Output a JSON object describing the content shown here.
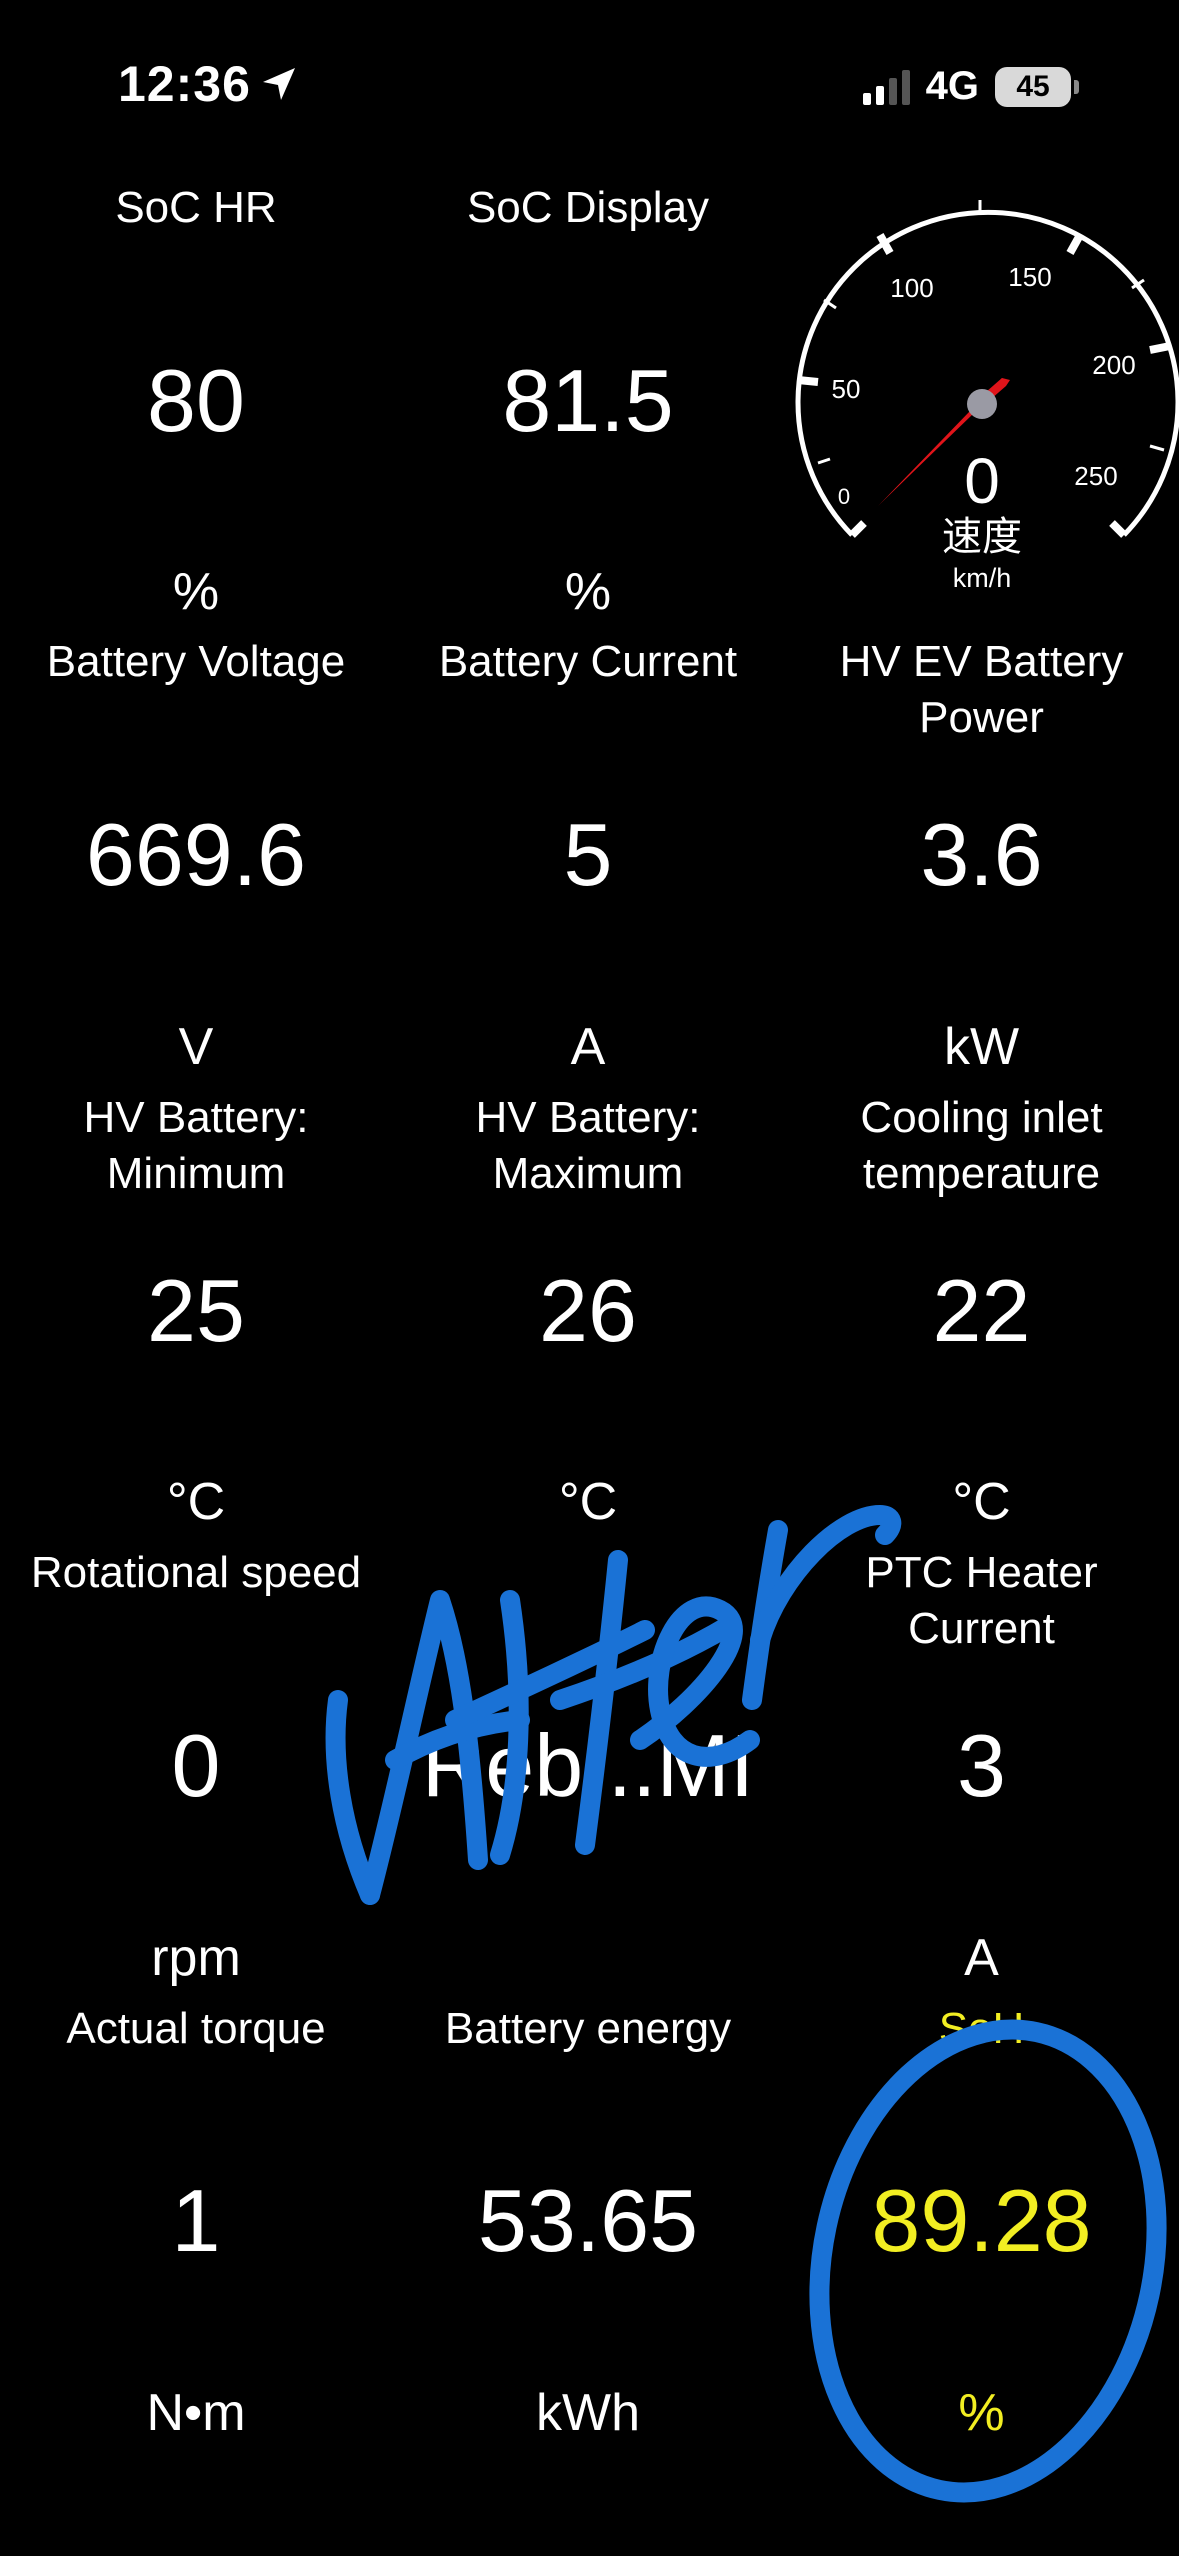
{
  "status_bar": {
    "time": "12:36",
    "network": "4G",
    "battery": "45"
  },
  "gauge": {
    "ticks": [
      "0",
      "50",
      "100",
      "150",
      "200",
      "250"
    ],
    "value": "0",
    "speed_value": 0,
    "label": "速度",
    "unit": "km/h"
  },
  "tiles": [
    {
      "label": "SoC HR",
      "value": "80",
      "unit": "%"
    },
    {
      "label": "SoC Display",
      "value": "81.5",
      "unit": "%"
    },
    {
      "label": "Battery Voltage",
      "value": "669.6",
      "unit": "V"
    },
    {
      "label": "Battery Current",
      "value": "5",
      "unit": "A"
    },
    {
      "label": "HV EV Battery Power",
      "value": "3.6",
      "unit": "kW"
    },
    {
      "label": "HV Battery: Minimum",
      "value": "25",
      "unit": "°C"
    },
    {
      "label": "HV Battery: Maximum",
      "value": "26",
      "unit": "°C"
    },
    {
      "label": "Cooling inlet temperature",
      "value": "22",
      "unit": "°C"
    },
    {
      "label": "Rotational speed",
      "value": "0",
      "unit": "rpm"
    },
    {
      "label": "",
      "value": "Reb...MI",
      "unit": ""
    },
    {
      "label": "PTC Heater Current",
      "value": "3",
      "unit": "A"
    },
    {
      "label": "Actual torque",
      "value": "1",
      "unit": "N•m"
    },
    {
      "label": "Battery energy",
      "value": "53.65",
      "unit": "kWh"
    },
    {
      "label": "SoH",
      "value": "89.28",
      "unit": "%"
    }
  ],
  "annotation": {
    "handwritten_text": "After",
    "color": "#1a72d6"
  },
  "colors": {
    "highlight": "#f2ee22",
    "needle": "#e0141a"
  }
}
